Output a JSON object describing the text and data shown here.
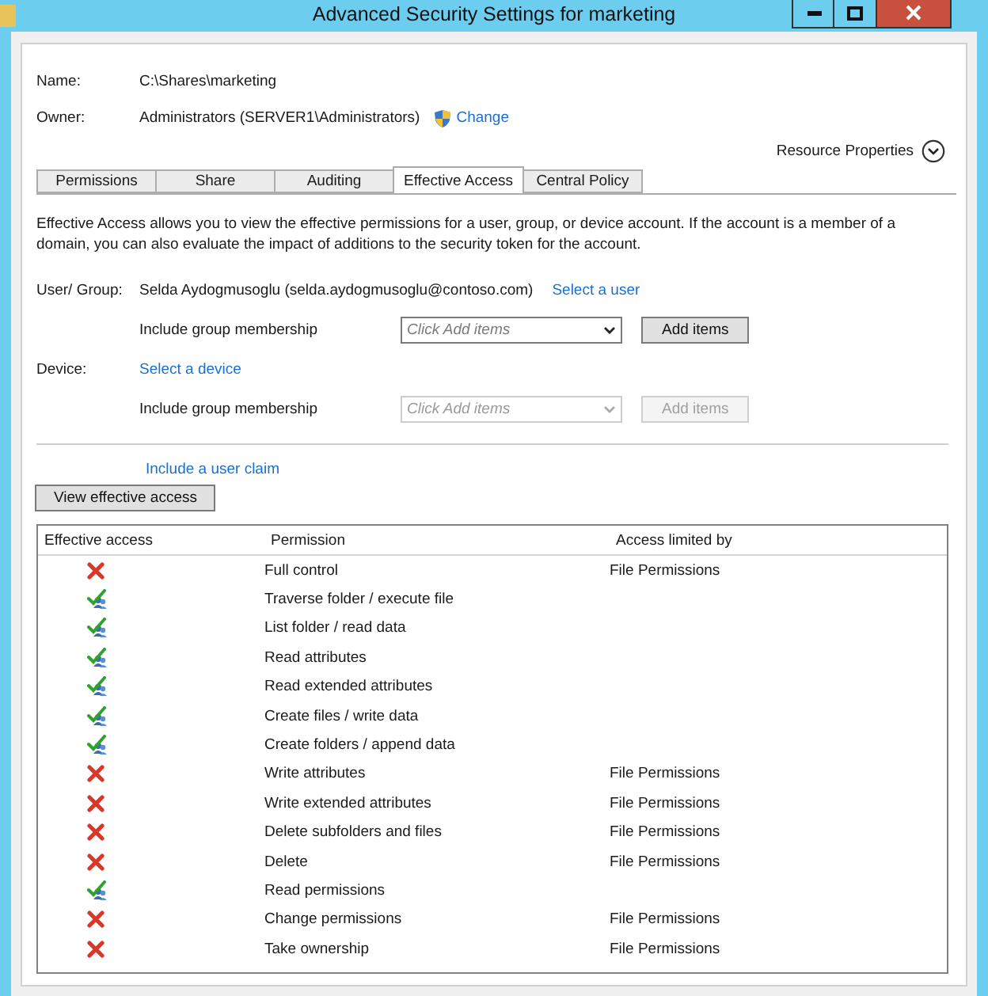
{
  "window": {
    "title": "Advanced Security Settings for marketing"
  },
  "name": {
    "label": "Name:",
    "value": "C:\\Shares\\marketing"
  },
  "owner": {
    "label": "Owner:",
    "value": "Administrators (SERVER1\\Administrators)",
    "link": "Change"
  },
  "resource_properties": "Resource Properties",
  "tabs": [
    {
      "label": "Permissions",
      "selected": false
    },
    {
      "label": "Share",
      "selected": false
    },
    {
      "label": "Auditing",
      "selected": false
    },
    {
      "label": "Effective Access",
      "selected": true
    },
    {
      "label": "Central Policy",
      "selected": false
    }
  ],
  "description": "Effective Access allows you to view the effective permissions for a user, group, or device account. If the account is a member of a domain, you can also evaluate the impact of additions to the security token for the account.",
  "user_group": {
    "label": "User/ Group:",
    "value": "Selda Aydogmusoglu (selda.aydogmusoglu@contoso.com)",
    "link": "Select a user",
    "membership": {
      "label": "Include group membership",
      "placeholder": "Click Add items",
      "button": "Add items",
      "disabled": false
    }
  },
  "device": {
    "label": "Device:",
    "link": "Select a device",
    "membership": {
      "label": "Include group membership",
      "placeholder": "Click Add items",
      "button": "Add items",
      "disabled": true
    }
  },
  "user_claim_link": "Include a user claim",
  "view_button": "View effective access",
  "table": {
    "columns": [
      "Effective access",
      "Permission",
      "Access limited by"
    ],
    "rows": [
      {
        "allowed": false,
        "permission": "Full control",
        "limited_by": "File Permissions"
      },
      {
        "allowed": true,
        "permission": "Traverse folder / execute file"
      },
      {
        "allowed": true,
        "permission": "List folder / read data"
      },
      {
        "allowed": true,
        "permission": "Read attributes"
      },
      {
        "allowed": true,
        "permission": "Read extended attributes"
      },
      {
        "allowed": true,
        "permission": "Create files / write data"
      },
      {
        "allowed": true,
        "permission": "Create folders / append data"
      },
      {
        "allowed": false,
        "permission": "Write attributes",
        "limited_by": "File Permissions"
      },
      {
        "allowed": false,
        "permission": "Write extended attributes",
        "limited_by": "File Permissions"
      },
      {
        "allowed": false,
        "permission": "Delete subfolders and files",
        "limited_by": "File Permissions"
      },
      {
        "allowed": false,
        "permission": "Delete",
        "limited_by": "File Permissions"
      },
      {
        "allowed": true,
        "permission": "Read permissions"
      },
      {
        "allowed": false,
        "permission": "Change permissions",
        "limited_by": "File Permissions"
      },
      {
        "allowed": false,
        "permission": "Take ownership",
        "limited_by": "File Permissions"
      }
    ]
  }
}
